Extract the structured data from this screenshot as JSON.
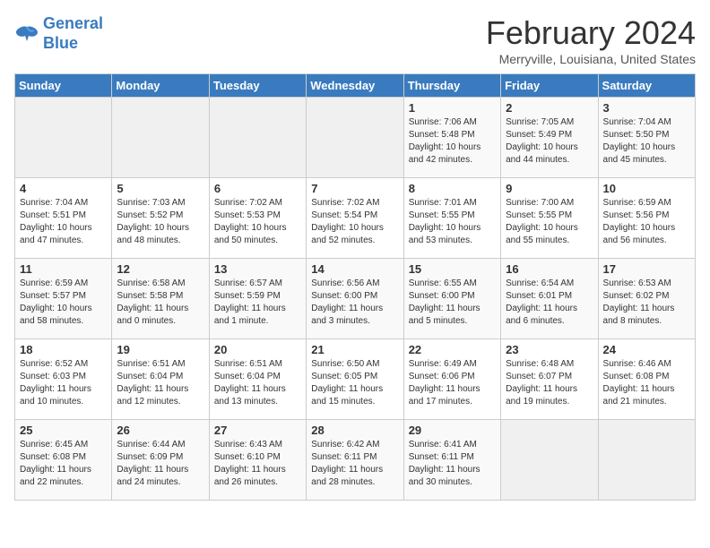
{
  "logo": {
    "line1": "General",
    "line2": "Blue"
  },
  "title": "February 2024",
  "subtitle": "Merryville, Louisiana, United States",
  "days_of_week": [
    "Sunday",
    "Monday",
    "Tuesday",
    "Wednesday",
    "Thursday",
    "Friday",
    "Saturday"
  ],
  "weeks": [
    [
      {
        "day": "",
        "info": ""
      },
      {
        "day": "",
        "info": ""
      },
      {
        "day": "",
        "info": ""
      },
      {
        "day": "",
        "info": ""
      },
      {
        "day": "1",
        "info": "Sunrise: 7:06 AM\nSunset: 5:48 PM\nDaylight: 10 hours\nand 42 minutes."
      },
      {
        "day": "2",
        "info": "Sunrise: 7:05 AM\nSunset: 5:49 PM\nDaylight: 10 hours\nand 44 minutes."
      },
      {
        "day": "3",
        "info": "Sunrise: 7:04 AM\nSunset: 5:50 PM\nDaylight: 10 hours\nand 45 minutes."
      }
    ],
    [
      {
        "day": "4",
        "info": "Sunrise: 7:04 AM\nSunset: 5:51 PM\nDaylight: 10 hours\nand 47 minutes."
      },
      {
        "day": "5",
        "info": "Sunrise: 7:03 AM\nSunset: 5:52 PM\nDaylight: 10 hours\nand 48 minutes."
      },
      {
        "day": "6",
        "info": "Sunrise: 7:02 AM\nSunset: 5:53 PM\nDaylight: 10 hours\nand 50 minutes."
      },
      {
        "day": "7",
        "info": "Sunrise: 7:02 AM\nSunset: 5:54 PM\nDaylight: 10 hours\nand 52 minutes."
      },
      {
        "day": "8",
        "info": "Sunrise: 7:01 AM\nSunset: 5:55 PM\nDaylight: 10 hours\nand 53 minutes."
      },
      {
        "day": "9",
        "info": "Sunrise: 7:00 AM\nSunset: 5:55 PM\nDaylight: 10 hours\nand 55 minutes."
      },
      {
        "day": "10",
        "info": "Sunrise: 6:59 AM\nSunset: 5:56 PM\nDaylight: 10 hours\nand 56 minutes."
      }
    ],
    [
      {
        "day": "11",
        "info": "Sunrise: 6:59 AM\nSunset: 5:57 PM\nDaylight: 10 hours\nand 58 minutes."
      },
      {
        "day": "12",
        "info": "Sunrise: 6:58 AM\nSunset: 5:58 PM\nDaylight: 11 hours\nand 0 minutes."
      },
      {
        "day": "13",
        "info": "Sunrise: 6:57 AM\nSunset: 5:59 PM\nDaylight: 11 hours\nand 1 minute."
      },
      {
        "day": "14",
        "info": "Sunrise: 6:56 AM\nSunset: 6:00 PM\nDaylight: 11 hours\nand 3 minutes."
      },
      {
        "day": "15",
        "info": "Sunrise: 6:55 AM\nSunset: 6:00 PM\nDaylight: 11 hours\nand 5 minutes."
      },
      {
        "day": "16",
        "info": "Sunrise: 6:54 AM\nSunset: 6:01 PM\nDaylight: 11 hours\nand 6 minutes."
      },
      {
        "day": "17",
        "info": "Sunrise: 6:53 AM\nSunset: 6:02 PM\nDaylight: 11 hours\nand 8 minutes."
      }
    ],
    [
      {
        "day": "18",
        "info": "Sunrise: 6:52 AM\nSunset: 6:03 PM\nDaylight: 11 hours\nand 10 minutes."
      },
      {
        "day": "19",
        "info": "Sunrise: 6:51 AM\nSunset: 6:04 PM\nDaylight: 11 hours\nand 12 minutes."
      },
      {
        "day": "20",
        "info": "Sunrise: 6:51 AM\nSunset: 6:04 PM\nDaylight: 11 hours\nand 13 minutes."
      },
      {
        "day": "21",
        "info": "Sunrise: 6:50 AM\nSunset: 6:05 PM\nDaylight: 11 hours\nand 15 minutes."
      },
      {
        "day": "22",
        "info": "Sunrise: 6:49 AM\nSunset: 6:06 PM\nDaylight: 11 hours\nand 17 minutes."
      },
      {
        "day": "23",
        "info": "Sunrise: 6:48 AM\nSunset: 6:07 PM\nDaylight: 11 hours\nand 19 minutes."
      },
      {
        "day": "24",
        "info": "Sunrise: 6:46 AM\nSunset: 6:08 PM\nDaylight: 11 hours\nand 21 minutes."
      }
    ],
    [
      {
        "day": "25",
        "info": "Sunrise: 6:45 AM\nSunset: 6:08 PM\nDaylight: 11 hours\nand 22 minutes."
      },
      {
        "day": "26",
        "info": "Sunrise: 6:44 AM\nSunset: 6:09 PM\nDaylight: 11 hours\nand 24 minutes."
      },
      {
        "day": "27",
        "info": "Sunrise: 6:43 AM\nSunset: 6:10 PM\nDaylight: 11 hours\nand 26 minutes."
      },
      {
        "day": "28",
        "info": "Sunrise: 6:42 AM\nSunset: 6:11 PM\nDaylight: 11 hours\nand 28 minutes."
      },
      {
        "day": "29",
        "info": "Sunrise: 6:41 AM\nSunset: 6:11 PM\nDaylight: 11 hours\nand 30 minutes."
      },
      {
        "day": "",
        "info": ""
      },
      {
        "day": "",
        "info": ""
      }
    ]
  ]
}
